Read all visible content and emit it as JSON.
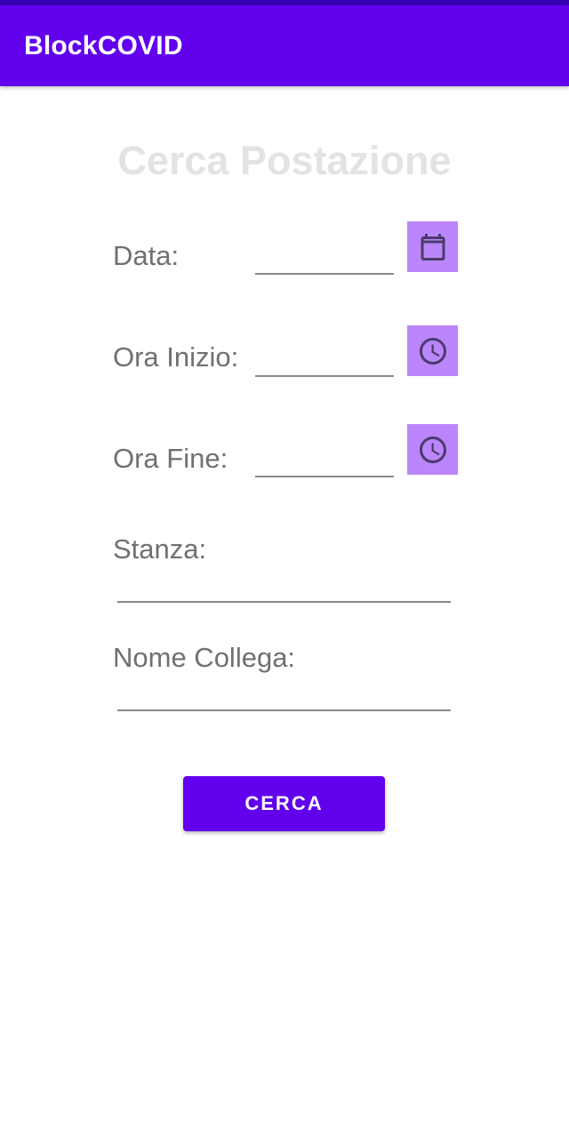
{
  "app_bar": {
    "title": "BlockCOVID"
  },
  "page": {
    "title": "Cerca Postazione"
  },
  "form": {
    "date": {
      "label": "Data:",
      "value": "",
      "icon": "calendar-icon"
    },
    "start_time": {
      "label": "Ora Inizio:",
      "value": "",
      "icon": "clock-icon"
    },
    "end_time": {
      "label": "Ora Fine:",
      "value": "",
      "icon": "clock-icon"
    },
    "room": {
      "label": "Stanza:",
      "value": ""
    },
    "colleague": {
      "label": "Nome Collega:",
      "value": ""
    }
  },
  "search_button": {
    "label": "CERCA"
  },
  "colors": {
    "primary": "#6200EE",
    "primary_dark": "#3700B3",
    "icon_button_bg": "#BB86FC",
    "title_text": "#E3E3E3",
    "label_text": "#707070"
  }
}
